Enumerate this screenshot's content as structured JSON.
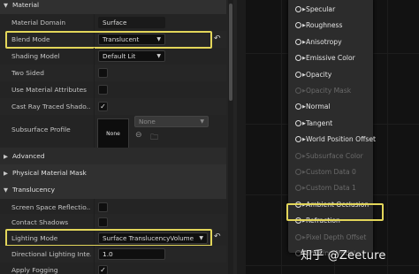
{
  "left_panel": {
    "material_section": "Material",
    "rows": {
      "material_domain": {
        "label": "Material Domain",
        "value": "Surface"
      },
      "blend_mode": {
        "label": "Blend Mode",
        "value": "Translucent"
      },
      "shading_model": {
        "label": "Shading Model",
        "value": "Default Lit"
      },
      "two_sided": {
        "label": "Two Sided",
        "checked": false
      },
      "use_material_attributes": {
        "label": "Use Material Attributes",
        "checked": false
      },
      "cast_ray_traced_shadows": {
        "label": "Cast Ray Traced Shado...",
        "checked": true
      },
      "subsurface_profile": {
        "label": "Subsurface Profile",
        "texture": "None",
        "combo": "None"
      }
    },
    "advanced_section": "Advanced",
    "physical_material_mask_section": "Physical Material Mask",
    "translucency_section": "Translucency",
    "translucency_rows": {
      "screen_space_reflections": {
        "label": "Screen Space Reflectio...",
        "checked": false
      },
      "contact_shadows": {
        "label": "Contact Shadows",
        "checked": false
      },
      "lighting_mode": {
        "label": "Lighting Mode",
        "value": "Surface TranslucencyVolume"
      },
      "directional_lighting_intensity": {
        "label": "Directional Lighting Inte...",
        "value": "1.0"
      },
      "apply_fogging": {
        "label": "Apply Fogging",
        "checked": true
      }
    },
    "reset_icon": "reset-arrow-icon",
    "highlight_color": "#e3d65a"
  },
  "material_node": {
    "pins": [
      {
        "label": "Specular",
        "enabled": true
      },
      {
        "label": "Roughness",
        "enabled": true
      },
      {
        "label": "Anisotropy",
        "enabled": true
      },
      {
        "label": "Emissive Color",
        "enabled": true
      },
      {
        "label": "Opacity",
        "enabled": true
      },
      {
        "label": "Opacity Mask",
        "enabled": false
      },
      {
        "label": "Normal",
        "enabled": true
      },
      {
        "label": "Tangent",
        "enabled": true
      },
      {
        "label": "World Position Offset",
        "enabled": true
      },
      {
        "label": "Subsurface Color",
        "enabled": false
      },
      {
        "label": "Custom Data 0",
        "enabled": false
      },
      {
        "label": "Custom Data 1",
        "enabled": false
      },
      {
        "label": "Ambient Occlusion",
        "enabled": true
      },
      {
        "label": "Refraction",
        "enabled": true
      },
      {
        "label": "Pixel Depth Offset",
        "enabled": false
      },
      {
        "label": "Shading Model",
        "enabled": false
      }
    ]
  },
  "watermark": "知乎 @Zeeture"
}
